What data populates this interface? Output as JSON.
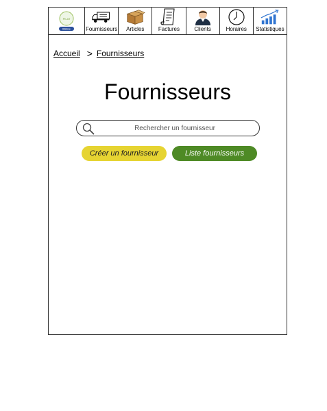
{
  "colors": {
    "create_button": "#e6d432",
    "list_button": "#4e8a25",
    "border": "#333333"
  },
  "nav": {
    "logo": {
      "text_top": "PILAT",
      "text_bottom": "Bâtisse"
    },
    "items": [
      {
        "label": "Fournisseurs",
        "icon": "truck-icon"
      },
      {
        "label": "Articles",
        "icon": "box-icon"
      },
      {
        "label": "Factures",
        "icon": "invoice-icon"
      },
      {
        "label": "Clients",
        "icon": "person-icon"
      },
      {
        "label": "Horaires",
        "icon": "clock-icon"
      },
      {
        "label": "Statistiques",
        "icon": "bar-chart-icon"
      }
    ]
  },
  "breadcrumb": {
    "home": "Accueil",
    "separator": ">",
    "current": "Fournisseurs"
  },
  "page": {
    "title": "Fournisseurs"
  },
  "search": {
    "placeholder": "Rechercher un fournisseur",
    "value": ""
  },
  "actions": {
    "create_label": "Créer un fournisseur",
    "list_label": "Liste fournisseurs"
  }
}
